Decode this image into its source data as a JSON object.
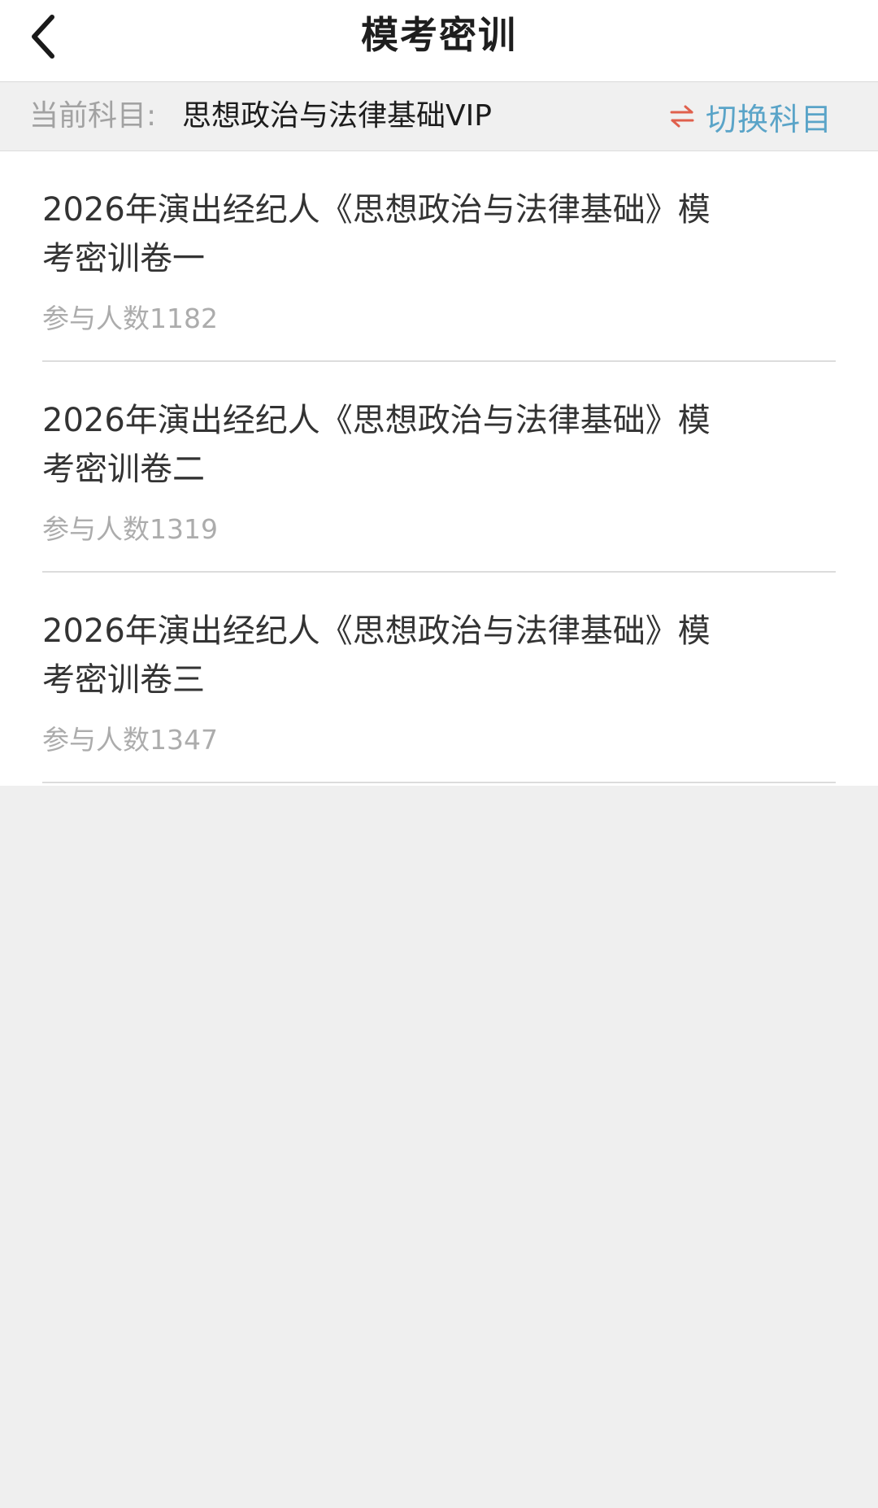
{
  "header": {
    "back_icon": "chevron-left-icon",
    "title": "模考密训"
  },
  "subject_bar": {
    "label": "当前科目:",
    "value": "思想政治与法律基础VIP",
    "switch_icon": "swap-arrows-icon",
    "switch_label": "切换科目",
    "colors": {
      "switch_icon": "#e0604d",
      "switch_label": "#5aa4c8"
    }
  },
  "exams": [
    {
      "title_line1": "2026年演出经纪人《思想政治与法律基础》模",
      "title_line2": "考密训卷一",
      "participants": "参与人数1182"
    },
    {
      "title_line1": "2026年演出经纪人《思想政治与法律基础》模",
      "title_line2": "考密训卷二",
      "participants": "参与人数1319"
    },
    {
      "title_line1": "2026年演出经纪人《思想政治与法律基础》模",
      "title_line2": "考密训卷三",
      "participants": "参与人数1347"
    }
  ]
}
